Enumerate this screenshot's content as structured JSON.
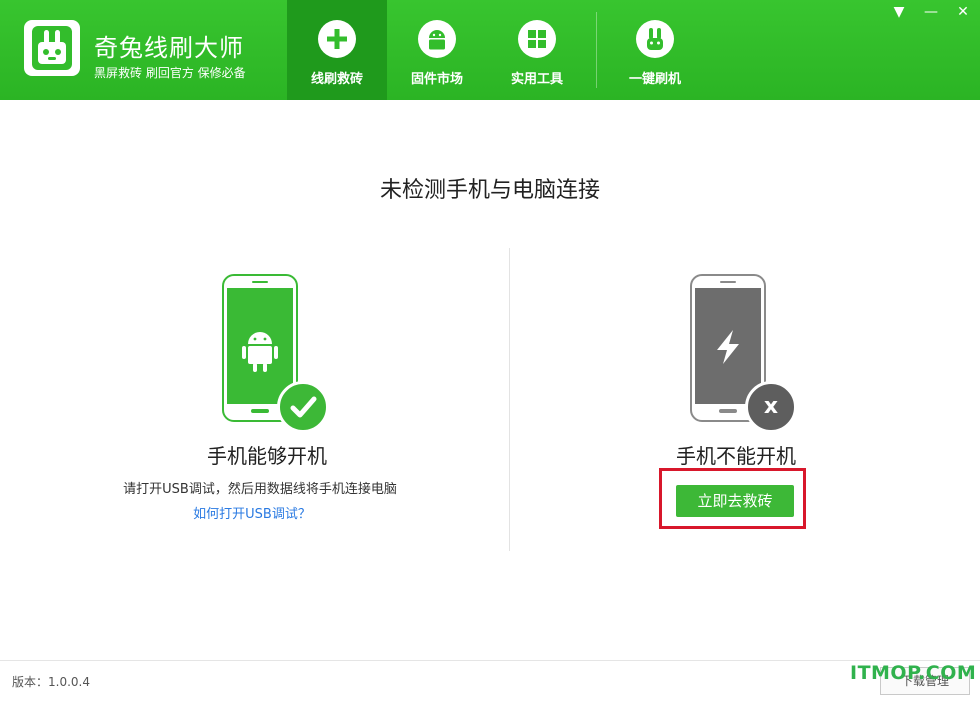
{
  "header": {
    "app_title": "奇兔线刷大师",
    "app_slogan": "黑屏救砖 刷回官方 保修必备",
    "nav": [
      {
        "label": "线刷救砖",
        "icon": "plus-icon",
        "active": true
      },
      {
        "label": "固件市场",
        "icon": "android-icon",
        "active": false
      },
      {
        "label": "实用工具",
        "icon": "windows-grid-icon",
        "active": false
      },
      {
        "label": "一键刷机",
        "icon": "rabbit-icon",
        "active": false
      }
    ],
    "window_controls": [
      "▼",
      "—",
      "✕"
    ]
  },
  "main": {
    "title": "未检测手机与电脑连接",
    "left_card": {
      "title": "手机能够开机",
      "description": "请打开USB调试，然后用数据线将手机连接电脑",
      "link": "如何打开USB调试？",
      "phone_icon": "android-icon",
      "badge_icon": "check-icon"
    },
    "right_card": {
      "title": "手机不能开机",
      "button": "立即去救砖",
      "phone_icon": "lightning-icon",
      "badge_icon": "x-icon",
      "badge_text": "x"
    }
  },
  "footer": {
    "version": "版本：1.0.0.4",
    "download_manager": "下载管理"
  },
  "watermark": "ITMOP.COM",
  "colors": {
    "brand_green": "#33bd2c",
    "active_nav": "#1f9a1c",
    "button_green": "#3db837",
    "highlight_red": "#d8172b",
    "phone_gray": "#6d6d6d",
    "link_blue": "#2a7ae2"
  }
}
